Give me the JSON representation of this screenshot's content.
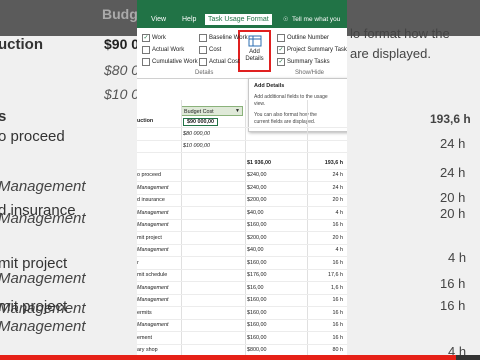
{
  "background": {
    "left_texts": [
      {
        "text": "uction",
        "cls": "b"
      },
      {
        "text": "s",
        "cls": "b"
      },
      {
        "text": "o proceed",
        "cls": ""
      },
      {
        "text": "Management",
        "cls": "it"
      },
      {
        "text": "d insurance",
        "cls": ""
      },
      {
        "text": "Management",
        "cls": "it"
      },
      {
        "text": "mit project",
        "cls": ""
      },
      {
        "text": "Management",
        "cls": "it"
      },
      {
        "text": "Management",
        "cls": "it"
      },
      {
        "text": "mit project",
        "cls": ""
      },
      {
        "text": "Management",
        "cls": "it"
      }
    ],
    "top_left_values": [
      "Budg",
      "$90 0",
      "$80 0",
      "$10 00"
    ],
    "right_texts": [
      {
        "text": "lo format how the"
      },
      {
        "text": "are displayed."
      },
      {
        "text": "193,6 h"
      },
      {
        "text": "24 h"
      },
      {
        "text": "24 h"
      },
      {
        "text": "20 h"
      },
      {
        "text": "20 h"
      },
      {
        "text": "4 h"
      },
      {
        "text": "16 h"
      },
      {
        "text": "16 h"
      },
      {
        "text": "4 h"
      }
    ]
  },
  "ribbon": {
    "tabs": [
      "View",
      "Help",
      "Task Usage Format"
    ],
    "tell_me": "Tell me what you",
    "checkboxes_col1": [
      {
        "label": "Work",
        "checked": true
      },
      {
        "label": "Actual Work",
        "checked": false
      },
      {
        "label": "Cumulative Work",
        "checked": false
      }
    ],
    "checkboxes_col2": [
      {
        "label": "Baseline Work",
        "checked": false
      },
      {
        "label": "Cost",
        "checked": false
      },
      {
        "label": "Actual Cost",
        "checked": false
      }
    ],
    "checkboxes_col3": [
      {
        "label": "Outline Number",
        "checked": false
      },
      {
        "label": "Project Summary Task",
        "checked": true
      },
      {
        "label": "Summary Tasks",
        "checked": true
      }
    ],
    "add_details_label": "Add Details",
    "group_details": "Details",
    "group_show_hide": "Show/Hide"
  },
  "tooltip": {
    "title": "Add Details",
    "line1": "Add additional fields to the usage",
    "line2": "view.",
    "line3": "You can also format how the",
    "line4": "current fields are displayed."
  },
  "grid": {
    "column_header": "Budget Cost",
    "rows": [
      {
        "name": "uction",
        "budget": "$90 000,00",
        "cost": "",
        "work": "",
        "style": "b"
      },
      {
        "name": "",
        "budget": "$80 000,00",
        "cost": "",
        "work": "",
        "style": "it"
      },
      {
        "name": "",
        "budget": "$10 000,00",
        "cost": "",
        "work": "",
        "style": "it"
      },
      {
        "name": "",
        "budget": "",
        "cost": "$1 936,00",
        "work": "193,6 h",
        "style": "b"
      },
      {
        "name": "o proceed",
        "budget": "",
        "cost": "$240,00",
        "work": "24 h",
        "style": ""
      },
      {
        "name": "Management",
        "budget": "",
        "cost": "$240,00",
        "work": "24 h",
        "style": "it"
      },
      {
        "name": "d insurance",
        "budget": "",
        "cost": "$200,00",
        "work": "20 h",
        "style": ""
      },
      {
        "name": "Management",
        "budget": "",
        "cost": "$40,00",
        "work": "4 h",
        "style": "it"
      },
      {
        "name": "Management",
        "budget": "",
        "cost": "$160,00",
        "work": "16 h",
        "style": "it"
      },
      {
        "name": "mit project",
        "budget": "",
        "cost": "$200,00",
        "work": "20 h",
        "style": ""
      },
      {
        "name": "Management",
        "budget": "",
        "cost": "$40,00",
        "work": "4 h",
        "style": "it"
      },
      {
        "name": "r",
        "budget": "",
        "cost": "$160,00",
        "work": "16 h",
        "style": ""
      },
      {
        "name": "mit schedule",
        "budget": "",
        "cost": "$176,00",
        "work": "17,6 h",
        "style": ""
      },
      {
        "name": "Management",
        "budget": "",
        "cost": "$16,00",
        "work": "1,6 h",
        "style": "it"
      },
      {
        "name": "Management",
        "budget": "",
        "cost": "$160,00",
        "work": "16 h",
        "style": "it"
      },
      {
        "name": "ermits",
        "budget": "",
        "cost": "$160,00",
        "work": "16 h",
        "style": ""
      },
      {
        "name": "Management",
        "budget": "",
        "cost": "$160,00",
        "work": "16 h",
        "style": "it"
      },
      {
        "name": "ement",
        "budget": "",
        "cost": "$160,00",
        "work": "16 h",
        "style": ""
      },
      {
        "name": "ary shop",
        "budget": "",
        "cost": "$800,00",
        "work": "80 h",
        "style": ""
      }
    ]
  },
  "video_progress": 0.95,
  "colors": {
    "accent": "#217346",
    "highlight": "#e02020",
    "progress": "#e62117"
  }
}
